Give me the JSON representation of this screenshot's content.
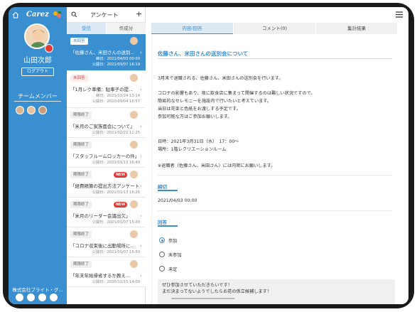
{
  "sidebar": {
    "brand": "Carez",
    "user_name": "山田次郎",
    "logout_label": "ログアウト",
    "team_title": "チームメンバー",
    "company": "株式会社ブライト・グ..."
  },
  "list": {
    "title": "アンケート",
    "tabs": [
      "受信",
      "作成分"
    ],
    "items": [
      {
        "status": "未回答",
        "title": "「佐藤さん、米田さんの送別...",
        "d1": "締切：2021/04/03 00:00",
        "d2": "公開日：2021/03/07 16:19",
        "new": ""
      },
      {
        "status": "未回答",
        "title": "「1月レク準備：駐車子の提...",
        "d1": "締切：2021/11/24 13:14",
        "d2": "公開日：2020/09/04 16:57",
        "new": ""
      },
      {
        "status": "期限終了",
        "title": "「米月のご家族面会について」",
        "d1": "公開日：2021/02/22 11:25",
        "d2": "",
        "new": ""
      },
      {
        "status": "期限終了",
        "title": "「スタッフルームロッカーの件」",
        "d1": "公開日：2021/01/13 16:40",
        "d2": "",
        "new": ""
      },
      {
        "status": "期限終了",
        "title": "「経費精算の提出方法アンケート」",
        "d1": "公開日：2021/01/13 16:26",
        "d2": "",
        "new": "NEW"
      },
      {
        "status": "期限終了",
        "title": "「米月のリーダー会議出欠」",
        "d1": "公開日：2021/01/07 15:00",
        "d2": "",
        "new": "NEW"
      },
      {
        "status": "期限終了",
        "title": "「コロナ収束後に出勤場所に...",
        "d1": "公開日：2021/01/07 15:50",
        "d2": "",
        "new": ""
      },
      {
        "status": "期限終了",
        "title": "「年末年始帰省するか教え...",
        "d1": "公開日：2020/12/15 14:00",
        "d2": "",
        "new": ""
      }
    ]
  },
  "main": {
    "tabs": [
      "内容/回答",
      "コメント(0)",
      "集計結果"
    ],
    "title": "佐藤さん、米田さんの送別会について",
    "body": [
      "3月末で退職される、佐藤さん、米田さんの送別会を行います。",
      "コロナの影響もあり、夜に飲食店に集まって開催するのは難しい状況ですので、",
      "簡易的なセレモニーを施設内で行いたいと考えています。",
      "当日は花束と色紙をお渡しする予定です。",
      "参加可能な方はご参加お願いします。",
      "日時：2021年3月31日（水）　17：00～",
      "場所：1階レクリエーションルーム",
      "※退職者（佐藤さん、米田さん）には内密にお願いします。"
    ],
    "deadline_label": "締切",
    "deadline_value": "2021/04/03 00:00",
    "answer_label": "回答",
    "options": [
      "参加",
      "未参加",
      "未定"
    ],
    "selected_option": "参加",
    "comment": [
      "ぜひ参加させていただきたいです！",
      "まだ決まってないようでしたらお花の係立候補します！"
    ]
  }
}
